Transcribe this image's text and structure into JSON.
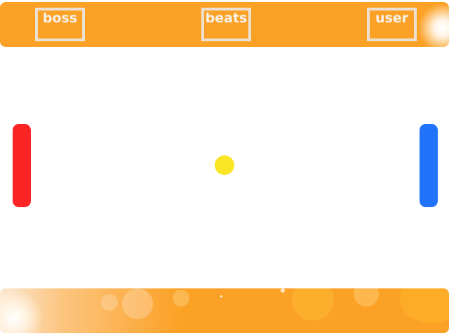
{
  "scoreboard": {
    "left_label": "boss",
    "center_label": "beats",
    "right_label": "user"
  },
  "colors": {
    "bar_orange": "#fba126",
    "box_border": "#ece1d1",
    "label_text": "#f7f1e8",
    "left_paddle": "#fb2525",
    "right_paddle": "#2273fb",
    "ball": "#fbe525",
    "field": "#ffffff"
  }
}
